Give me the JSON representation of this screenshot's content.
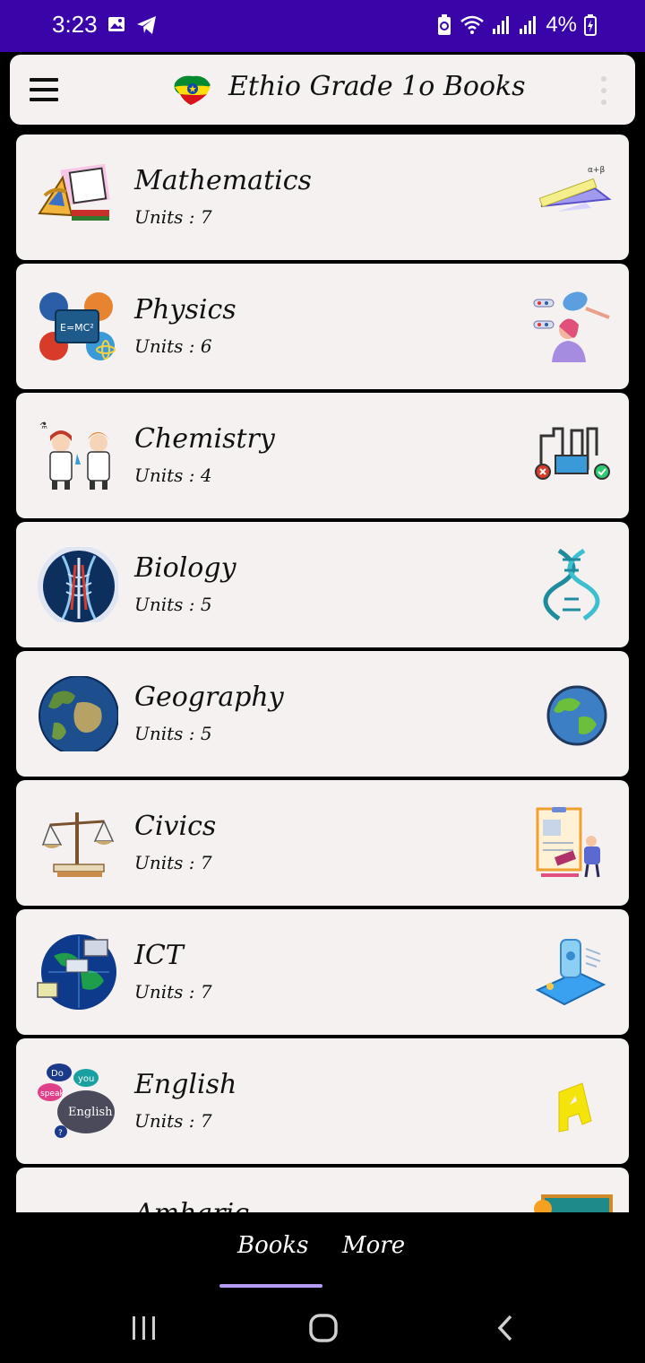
{
  "status_bar": {
    "time": "3:23",
    "battery": "4%",
    "icons": [
      "image-icon",
      "telegram-icon",
      "battery-saver-icon",
      "wifi-icon",
      "signal-icon",
      "signal-icon",
      "battery-charging-icon"
    ]
  },
  "app_bar": {
    "title": "Ethio Grade 1o Books",
    "icons": [
      "menu-icon",
      "ethiopia-flag-map-icon",
      "more-vertical-icon"
    ]
  },
  "books": [
    {
      "name": "Mathematics",
      "units": "Units : 7",
      "thumb": "math-tools-icon",
      "icon": "ruler-set-square-icon"
    },
    {
      "name": "Physics",
      "units": "Units : 6",
      "thumb": "physics-collage-icon",
      "icon": "physics-experiment-icon"
    },
    {
      "name": "Chemistry",
      "units": "Units : 4",
      "thumb": "kids-scientists-icon",
      "icon": "lab-tubes-icon"
    },
    {
      "name": "Biology",
      "units": "Units : 5",
      "thumb": "human-anatomy-icon",
      "icon": "dna-icon"
    },
    {
      "name": "Geography",
      "units": "Units : 5",
      "thumb": "earth-globe-icon",
      "icon": "globe-icon"
    },
    {
      "name": "Civics",
      "units": "Units : 7",
      "thumb": "justice-scales-icon",
      "icon": "gavel-document-icon"
    },
    {
      "name": "ICT",
      "units": "Units : 7",
      "thumb": "network-globe-icon",
      "icon": "smartphone-tech-icon"
    },
    {
      "name": "English",
      "units": "Units : 7",
      "thumb": "speech-bubbles-icon",
      "icon": "letter-a-icon"
    },
    {
      "name": "Amharic",
      "units": "",
      "thumb": "amharic-icon",
      "icon": "chalkboard-icon"
    }
  ],
  "bottom_nav": {
    "tabs": [
      "Books",
      "More"
    ],
    "active": "Books"
  },
  "system_nav": [
    "recent-apps-icon",
    "home-icon",
    "back-icon"
  ],
  "colors": {
    "status_bar": "#3a05a8",
    "card_bg": "#f5f1f1",
    "indicator": "#b59cf2",
    "background": "#000000"
  }
}
